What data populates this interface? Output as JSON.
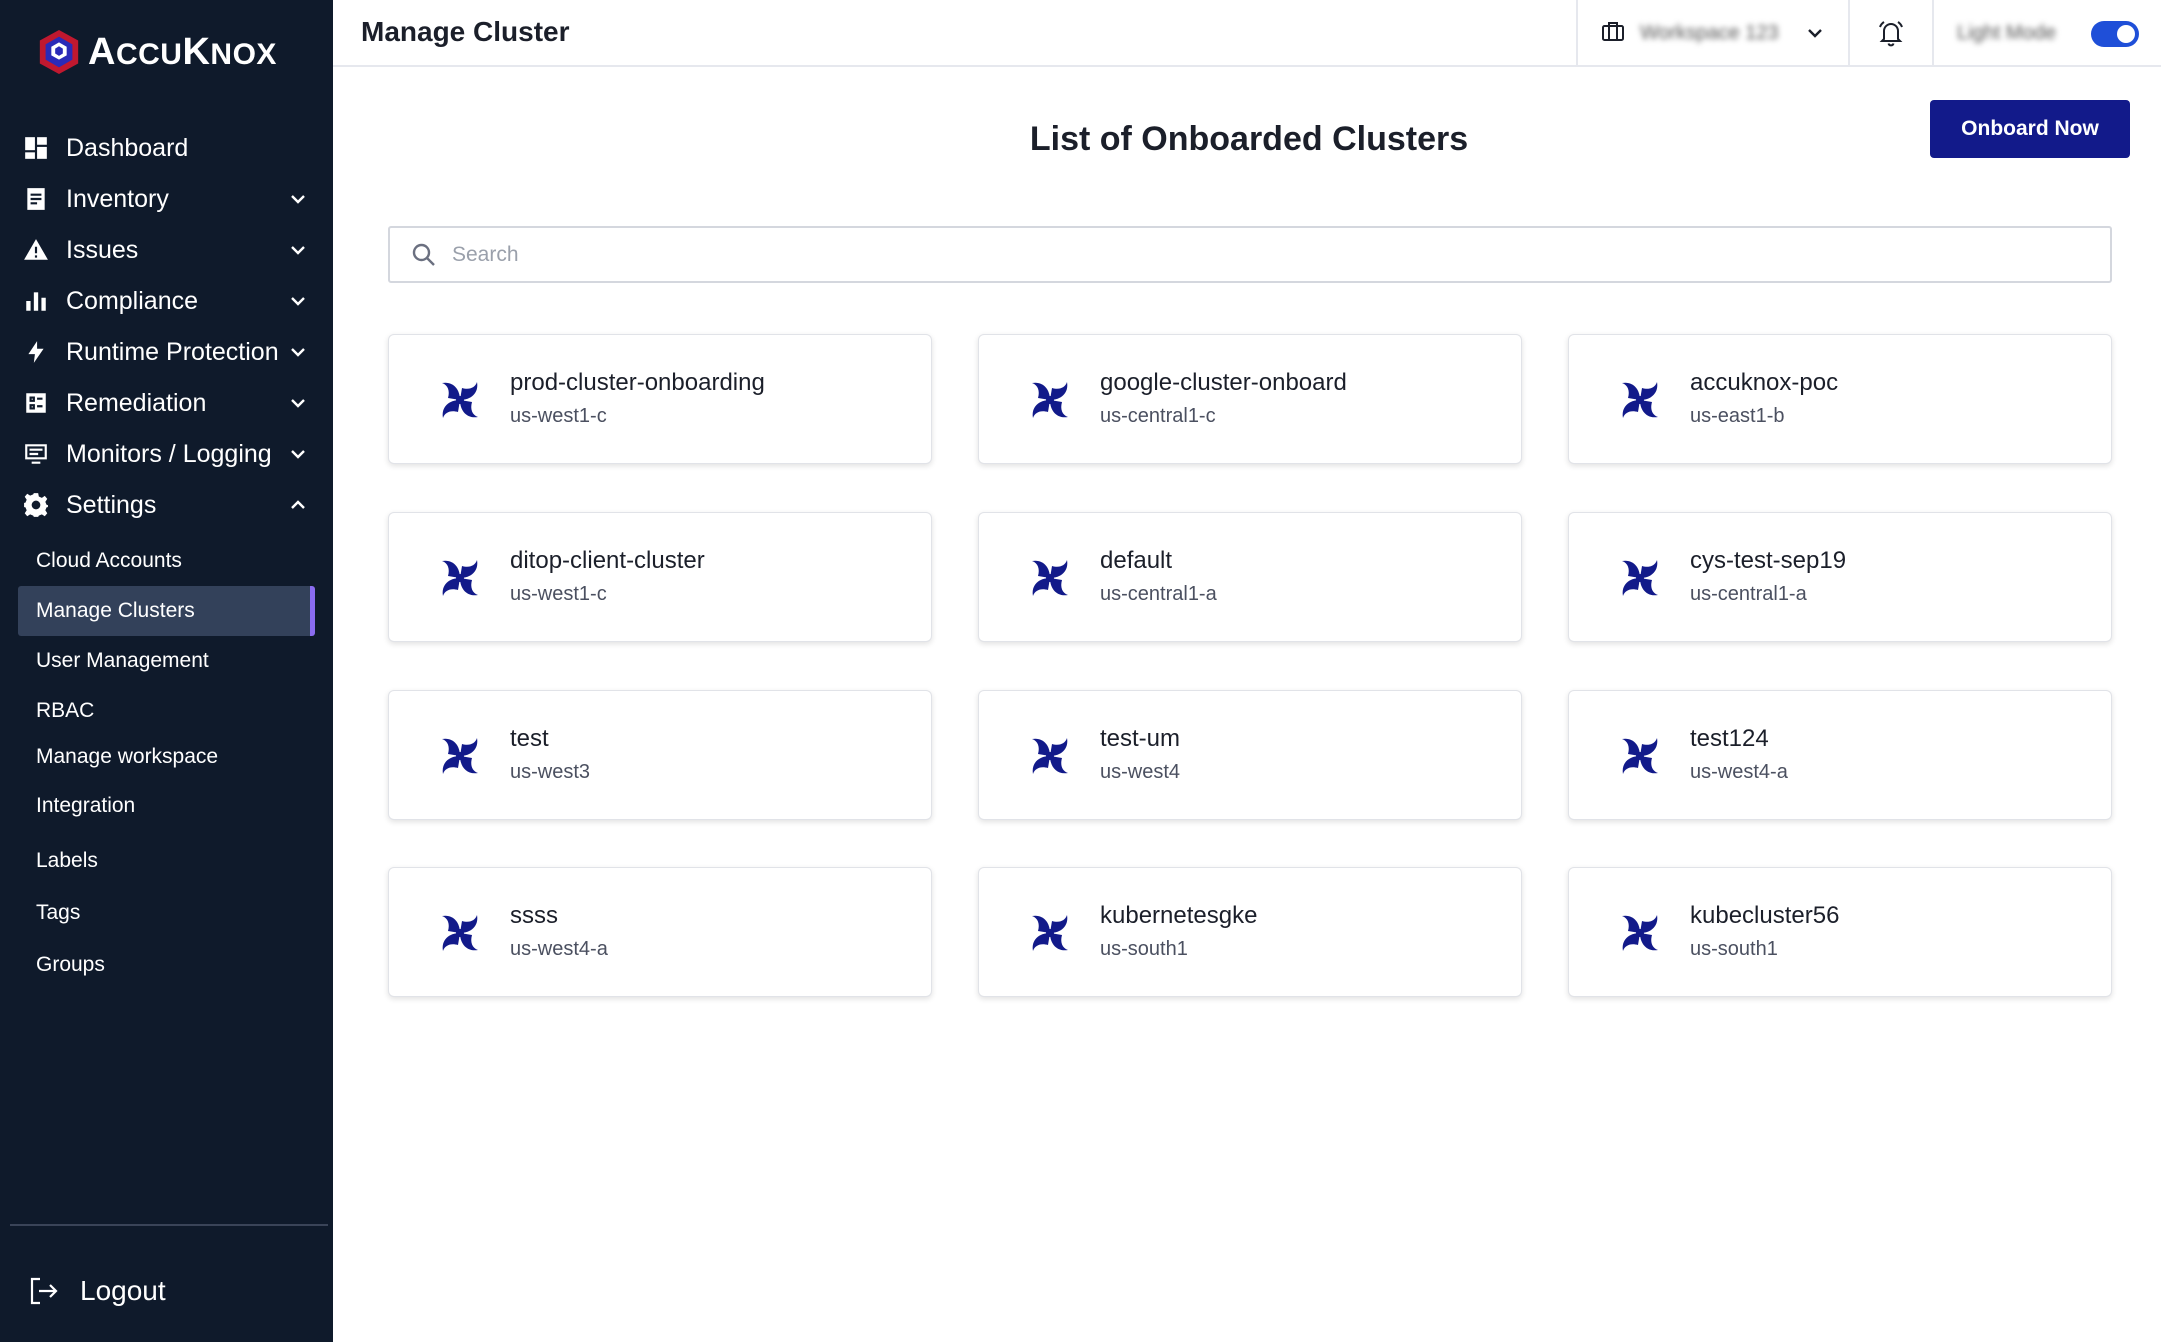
{
  "brand": {
    "name": "AccuKnox"
  },
  "sidebar": {
    "nav": [
      {
        "label": "Dashboard",
        "icon": "dashboard-icon",
        "chevron": ""
      },
      {
        "label": "Inventory",
        "icon": "inventory-icon",
        "chevron": "down"
      },
      {
        "label": "Issues",
        "icon": "warning-icon",
        "chevron": "down"
      },
      {
        "label": "Compliance",
        "icon": "bar-chart-icon",
        "chevron": "down"
      },
      {
        "label": "Runtime Protection",
        "icon": "bolt-icon",
        "chevron": "down"
      },
      {
        "label": "Remediation",
        "icon": "remediation-icon",
        "chevron": "down"
      },
      {
        "label": "Monitors / Logging",
        "icon": "monitor-icon",
        "chevron": "down"
      },
      {
        "label": "Settings",
        "icon": "gear-icon",
        "chevron": "up"
      }
    ],
    "settings_items": [
      {
        "label": "Cloud Accounts",
        "active": false
      },
      {
        "label": "Manage Clusters",
        "active": true
      },
      {
        "label": "User Management",
        "active": false
      },
      {
        "label": "RBAC",
        "active": false
      },
      {
        "label": "Manage workspace",
        "active": false
      },
      {
        "label": "Integration",
        "active": false
      },
      {
        "label": "Labels",
        "active": false
      },
      {
        "label": "Tags",
        "active": false
      },
      {
        "label": "Groups",
        "active": false
      }
    ],
    "logout_label": "Logout"
  },
  "topbar": {
    "title": "Manage Cluster",
    "workspace": "Workspace 123",
    "mode_label": "Light Mode",
    "mode_on": true
  },
  "main": {
    "heading": "List of Onboarded Clusters",
    "onboard_button": "Onboard Now",
    "search_placeholder": "Search",
    "clusters": [
      {
        "name": "prod-cluster-onboarding",
        "region": "us-west1-c"
      },
      {
        "name": "google-cluster-onboard",
        "region": "us-central1-c"
      },
      {
        "name": "accuknox-poc",
        "region": "us-east1-b"
      },
      {
        "name": "ditop-client-cluster",
        "region": "us-west1-c"
      },
      {
        "name": "default",
        "region": "us-central1-a"
      },
      {
        "name": "cys-test-sep19",
        "region": "us-central1-a"
      },
      {
        "name": "test",
        "region": "us-west3"
      },
      {
        "name": "test-um",
        "region": "us-west4"
      },
      {
        "name": "test124",
        "region": "us-west4-a"
      },
      {
        "name": "ssss",
        "region": "us-west4-a"
      },
      {
        "name": "kubernetesgke",
        "region": "us-south1"
      },
      {
        "name": "kubecluster56",
        "region": "us-south1"
      }
    ]
  },
  "colors": {
    "sidebar_bg": "#0f1a2b",
    "active_item_bg": "#33415a",
    "active_item_accent": "#8a6cf0",
    "primary_button": "#121a8a",
    "cluster_icon": "#121a8a",
    "toggle_on": "#1f4fd8"
  }
}
